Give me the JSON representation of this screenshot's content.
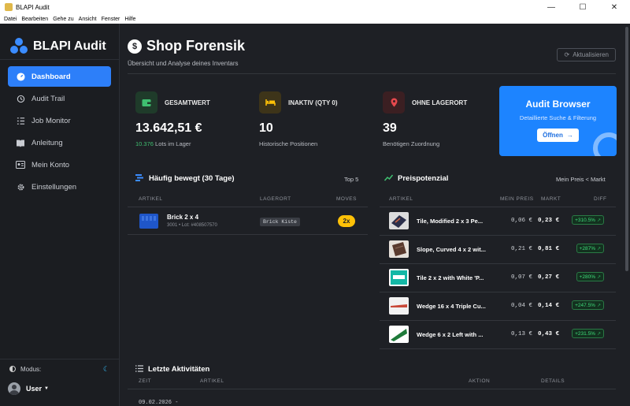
{
  "window": {
    "title": "BLAPI Audit",
    "minimize": "—",
    "maximize": "☐",
    "close": "✕"
  },
  "menu": [
    "Datei",
    "Bearbeiten",
    "Gehe zu",
    "Ansicht",
    "Fenster",
    "Hilfe"
  ],
  "sidebar": {
    "brand": "BLAPI Audit",
    "items": [
      {
        "label": "Dashboard",
        "icon": "gauge-icon",
        "active": true
      },
      {
        "label": "Audit Trail",
        "icon": "history-icon",
        "active": false
      },
      {
        "label": "Job Monitor",
        "icon": "tasks-icon",
        "active": false
      },
      {
        "label": "Anleitung",
        "icon": "book-icon",
        "active": false
      },
      {
        "label": "Mein Konto",
        "icon": "id-card-icon",
        "active": false
      },
      {
        "label": "Einstellungen",
        "icon": "gear-icon",
        "active": false
      }
    ],
    "mode_label": "Modus:",
    "user_label": "User"
  },
  "header": {
    "title": "Shop Forensik",
    "subtitle": "Übersicht und Analyse deines Inventars",
    "refresh_label": "Aktualisieren"
  },
  "stats": [
    {
      "label": "GESAMTWERT",
      "value": "13.642,51 €",
      "desc_highlight": "10.376",
      "desc": " Lots im Lager",
      "color": "#3fbf70",
      "bg": "#1f3b2a",
      "icon": "wallet-icon"
    },
    {
      "label": "INAKTIV (QTY 0)",
      "value": "10",
      "desc_highlight": "",
      "desc": "Historische Positionen",
      "color": "#ffc107",
      "bg": "#3d3419",
      "icon": "bed-icon"
    },
    {
      "label": "OHNE LAGERORT",
      "value": "39",
      "desc_highlight": "",
      "desc": "Benötigen Zuordnung",
      "color": "#e5484d",
      "bg": "#3b1f22",
      "icon": "map-pin-icon"
    }
  ],
  "browser": {
    "title": "Audit Browser",
    "subtitle": "Detaillierte Suche & Filterung",
    "button": "Öffnen"
  },
  "moved": {
    "title": "Häufig bewegt (30 Tage)",
    "right": "Top 5",
    "columns": [
      "ARTIKEL",
      "LAGERORT",
      "MOVES"
    ],
    "rows": [
      {
        "name": "Brick 2 x 4",
        "meta": "3001 • Lot: #408507570",
        "location": "Brick Kiste",
        "moves": "2x"
      }
    ]
  },
  "price": {
    "title": "Preispotenzial",
    "right": "Mein Preis < Markt",
    "columns": [
      "ARTIKEL",
      "MEIN PREIS",
      "MARKT",
      "DIFF"
    ],
    "rows": [
      {
        "name": "Tile, Modified 2 x 3 Pe...",
        "mine": "0,06 €",
        "market": "0,23 €",
        "diff": "+310.5%"
      },
      {
        "name": "Slope, Curved 4 x 2 wit...",
        "mine": "0,21 €",
        "market": "0,81 €",
        "diff": "+287%"
      },
      {
        "name": "Tile 2 x 2 with White 'P...",
        "mine": "0,07 €",
        "market": "0,27 €",
        "diff": "+280%"
      },
      {
        "name": "Wedge 16 x 4 Triple Cu...",
        "mine": "0,04 €",
        "market": "0,14 €",
        "diff": "+247.5%"
      },
      {
        "name": "Wedge 6 x 2 Left with ...",
        "mine": "0,13 €",
        "market": "0,43 €",
        "diff": "+231.5%"
      }
    ]
  },
  "activity": {
    "title": "Letzte Aktivitäten",
    "columns": [
      "ZEIT",
      "ARTIKEL",
      "AKTION",
      "DETAILS"
    ],
    "first_time": "09.02.2026 -"
  }
}
